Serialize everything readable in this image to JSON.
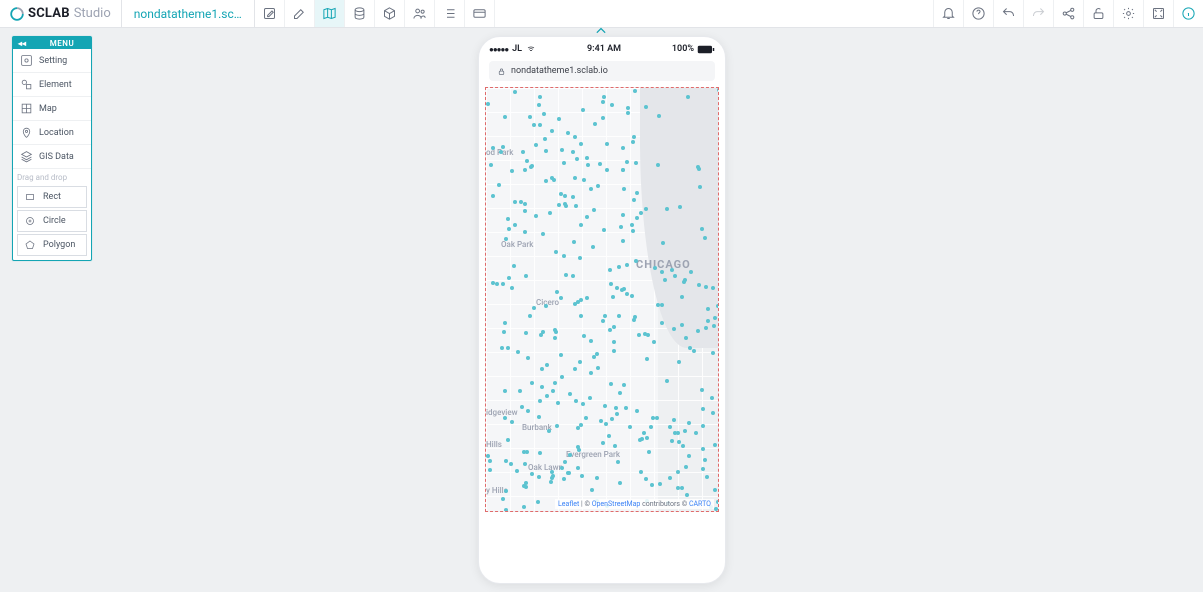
{
  "app": {
    "brand1": "SCLAB",
    "brand2": "Studio",
    "project": "nondatatheme1.sc…"
  },
  "sidebar": {
    "title": "MENU",
    "items": [
      {
        "label": "Setting"
      },
      {
        "label": "Element"
      },
      {
        "label": "Map"
      },
      {
        "label": "Location"
      },
      {
        "label": "GIS Data"
      }
    ],
    "section": "Drag and drop",
    "shapes": [
      {
        "label": "Rect"
      },
      {
        "label": "Circle"
      },
      {
        "label": "Polygon"
      }
    ]
  },
  "phone": {
    "carrier": "JL",
    "time": "9:41 AM",
    "battery": "100%",
    "url": "nondatatheme1.sclab.io"
  },
  "map": {
    "labels": {
      "chicago": "CHICAGO",
      "oakpark": "Oak Park",
      "cicero": "Cicero",
      "burbank": "Burbank",
      "oaklawn": "Oak Lawn",
      "evergreen": "Evergreen Park",
      "rpark": "od Park",
      "idgeview": "idgeview",
      "hill": "Hills",
      "yhills": "y Hills"
    },
    "attrib": {
      "leaflet": "Leaflet",
      "sep": " | © ",
      "osm": "OpenStreetMap",
      "contrib": " contributors © ",
      "carto": "CARTO"
    }
  }
}
